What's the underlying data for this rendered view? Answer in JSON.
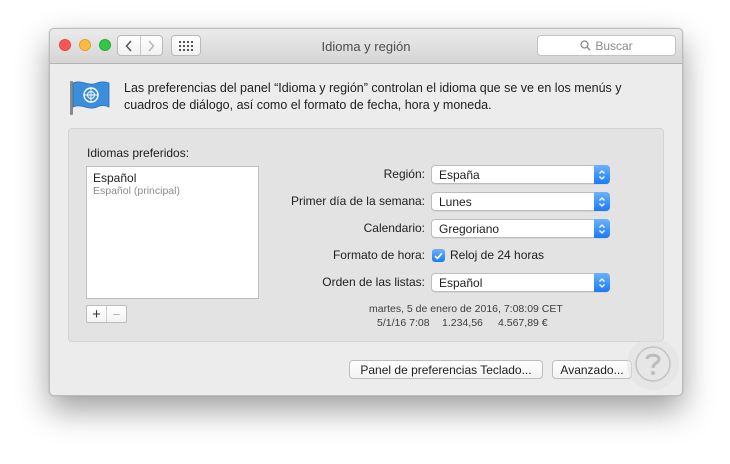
{
  "window": {
    "title": "Idioma y región",
    "search_placeholder": "Buscar"
  },
  "description": "Las preferencias del panel “Idioma y región” controlan el idioma que se ve en los menús y cuadros de diálogo, así como el formato de fecha, hora y moneda.",
  "languages": {
    "label": "Idiomas preferidos:",
    "items": [
      {
        "name": "Español",
        "sub": "Español (principal)"
      }
    ],
    "add_label": "+",
    "remove_label": "−"
  },
  "settings": {
    "region": {
      "label": "Región:",
      "value": "España"
    },
    "first_day": {
      "label": "Primer día de la semana:",
      "value": "Lunes"
    },
    "calendar": {
      "label": "Calendario:",
      "value": "Gregoriano"
    },
    "time_format": {
      "label": "Formato de hora:",
      "checkbox_label": "Reloj de 24 horas",
      "checked": true
    },
    "list_order": {
      "label": "Orden de las listas:",
      "value": "Español"
    }
  },
  "sample": {
    "line1": "martes, 5 de enero de 2016, 7:08:09 CET",
    "date_short": "5/1/16 7:08",
    "number": "1.234,56",
    "currency": "4.567,89 €"
  },
  "buttons": {
    "keyboard_prefs": "Panel de preferencias Teclado...",
    "advanced": "Avanzado..."
  },
  "colors": {
    "accent": "#1a7bf4",
    "close": "#fc5753",
    "minimize": "#fdbc40",
    "maximize": "#33c748",
    "flag_blue": "#3b8edb"
  },
  "icons": {
    "flag": "un-flag-icon",
    "search": "magnifier-icon",
    "watermark": "question-mark-icon"
  }
}
